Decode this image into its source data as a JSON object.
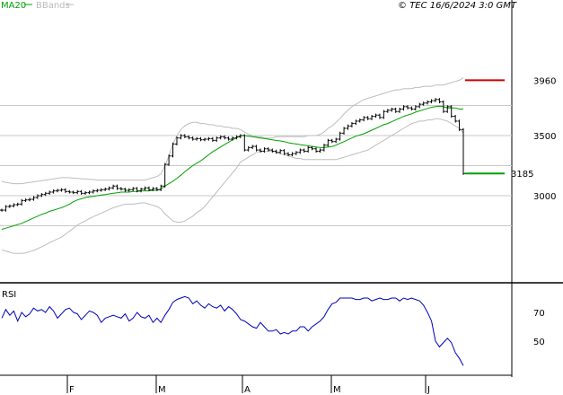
{
  "chart_data": [
    {
      "type": "candlestick",
      "copyright": "© TEC 16/6/2024 3:0 GMT",
      "legend": [
        {
          "name": "MA20",
          "color": "#00a000"
        },
        {
          "name": "BBands",
          "color": "#bbbbbb"
        }
      ],
      "y_ticks": [
        3000,
        3500
      ],
      "y_tick_labels": [
        "3000",
        "3500"
      ],
      "ylim": [
        2500,
        4000
      ],
      "resistance": {
        "value": 3960,
        "label": "3960",
        "color": "#cc0000"
      },
      "support": {
        "value": 3185,
        "label": "3185",
        "color": "#00a000"
      },
      "x_month_labels": [
        "F",
        "M",
        "A",
        "M",
        "J"
      ],
      "close": [
        2880,
        2910,
        2915,
        2925,
        2930,
        2960,
        2965,
        2970,
        2985,
        3000,
        3010,
        3020,
        3030,
        3040,
        3045,
        3050,
        3035,
        3030,
        3025,
        3035,
        3020,
        3025,
        3030,
        3040,
        3045,
        3050,
        3055,
        3065,
        3080,
        3060,
        3055,
        3045,
        3050,
        3060,
        3040,
        3055,
        3065,
        3050,
        3060,
        3050,
        3080,
        3260,
        3330,
        3430,
        3480,
        3500,
        3490,
        3480,
        3470,
        3475,
        3465,
        3470,
        3475,
        3460,
        3480,
        3490,
        3480,
        3470,
        3480,
        3490,
        3500,
        3380,
        3400,
        3410,
        3380,
        3370,
        3390,
        3380,
        3370,
        3360,
        3375,
        3350,
        3340,
        3350,
        3360,
        3380,
        3370,
        3400,
        3390,
        3370,
        3380,
        3420,
        3460,
        3450,
        3470,
        3520,
        3560,
        3580,
        3600,
        3620,
        3630,
        3650,
        3640,
        3660,
        3670,
        3650,
        3700,
        3710,
        3720,
        3700,
        3720,
        3740,
        3730,
        3720,
        3740,
        3760,
        3770,
        3780,
        3790,
        3800,
        3780,
        3700,
        3740,
        3660,
        3620,
        3550,
        3185
      ],
      "ma20": [
        2720,
        2730,
        2740,
        2750,
        2760,
        2770,
        2785,
        2800,
        2815,
        2830,
        2845,
        2855,
        2870,
        2880,
        2890,
        2900,
        2915,
        2930,
        2950,
        2965,
        2975,
        2985,
        2990,
        2995,
        3000,
        3005,
        3010,
        3015,
        3020,
        3025,
        3030,
        3030,
        3030,
        3035,
        3035,
        3040,
        3040,
        3040,
        3045,
        3045,
        3055,
        3080,
        3100,
        3120,
        3145,
        3170,
        3200,
        3225,
        3250,
        3270,
        3290,
        3315,
        3340,
        3365,
        3385,
        3405,
        3425,
        3445,
        3465,
        3480,
        3500,
        3500,
        3495,
        3490,
        3485,
        3480,
        3475,
        3470,
        3465,
        3460,
        3455,
        3450,
        3440,
        3435,
        3430,
        3425,
        3420,
        3415,
        3410,
        3405,
        3400,
        3400,
        3405,
        3410,
        3420,
        3435,
        3450,
        3465,
        3480,
        3495,
        3505,
        3515,
        3530,
        3545,
        3560,
        3575,
        3590,
        3600,
        3615,
        3630,
        3645,
        3660,
        3670,
        3680,
        3695,
        3705,
        3715,
        3725,
        3735,
        3740,
        3745,
        3740,
        3730,
        3730,
        3730,
        3720,
        3720
      ],
      "bb_upper": [
        3120,
        3110,
        3105,
        3100,
        3100,
        3100,
        3105,
        3110,
        3115,
        3120,
        3125,
        3130,
        3135,
        3140,
        3145,
        3150,
        3150,
        3150,
        3145,
        3145,
        3140,
        3140,
        3135,
        3135,
        3130,
        3130,
        3130,
        3130,
        3130,
        3130,
        3130,
        3130,
        3130,
        3130,
        3130,
        3130,
        3130,
        3140,
        3150,
        3160,
        3180,
        3250,
        3330,
        3430,
        3500,
        3550,
        3580,
        3600,
        3610,
        3610,
        3600,
        3600,
        3590,
        3590,
        3580,
        3580,
        3570,
        3570,
        3560,
        3560,
        3550,
        3530,
        3510,
        3500,
        3490,
        3490,
        3480,
        3480,
        3480,
        3490,
        3490,
        3490,
        3490,
        3490,
        3490,
        3490,
        3490,
        3500,
        3500,
        3500,
        3510,
        3530,
        3560,
        3580,
        3610,
        3640,
        3680,
        3710,
        3740,
        3760,
        3780,
        3800,
        3810,
        3820,
        3830,
        3840,
        3850,
        3860,
        3870,
        3880,
        3880,
        3890,
        3890,
        3890,
        3900,
        3900,
        3910,
        3910,
        3910,
        3920,
        3920,
        3920,
        3930,
        3940,
        3950,
        3960,
        3980
      ],
      "bb_lower": [
        2550,
        2540,
        2530,
        2520,
        2520,
        2520,
        2525,
        2535,
        2545,
        2560,
        2575,
        2590,
        2610,
        2625,
        2640,
        2655,
        2680,
        2705,
        2730,
        2755,
        2775,
        2790,
        2810,
        2825,
        2840,
        2855,
        2870,
        2885,
        2900,
        2910,
        2920,
        2930,
        2930,
        2930,
        2935,
        2940,
        2940,
        2930,
        2920,
        2910,
        2890,
        2850,
        2820,
        2790,
        2780,
        2780,
        2790,
        2810,
        2830,
        2860,
        2880,
        2910,
        2950,
        2990,
        3030,
        3070,
        3110,
        3150,
        3190,
        3230,
        3280,
        3300,
        3320,
        3340,
        3360,
        3370,
        3370,
        3370,
        3370,
        3360,
        3350,
        3340,
        3330,
        3320,
        3310,
        3310,
        3300,
        3300,
        3300,
        3300,
        3300,
        3300,
        3300,
        3300,
        3300,
        3310,
        3320,
        3330,
        3340,
        3350,
        3360,
        3370,
        3380,
        3400,
        3420,
        3440,
        3460,
        3480,
        3500,
        3520,
        3540,
        3560,
        3580,
        3600,
        3610,
        3620,
        3620,
        3630,
        3630,
        3640,
        3640,
        3630,
        3620,
        3600,
        3580,
        3560,
        3520
      ]
    },
    {
      "type": "line",
      "title": "RSI",
      "y_ticks": [
        50,
        70
      ],
      "y_tick_labels": [
        "50",
        "70"
      ],
      "ylim": [
        30,
        90
      ],
      "x_month_labels": [
        "F",
        "M",
        "A",
        "M",
        "J"
      ],
      "series": [
        {
          "name": "RSI",
          "color": "#0000bb",
          "values": [
            66,
            72,
            68,
            71,
            64,
            70,
            67,
            69,
            73,
            71,
            72,
            70,
            74,
            71,
            66,
            69,
            72,
            73,
            70,
            69,
            65,
            68,
            71,
            70,
            68,
            63,
            66,
            67,
            68,
            67,
            66,
            69,
            64,
            66,
            70,
            67,
            66,
            68,
            63,
            66,
            63,
            68,
            72,
            77,
            79,
            80,
            81,
            80,
            76,
            78,
            75,
            73,
            76,
            74,
            73,
            75,
            71,
            74,
            72,
            69,
            65,
            64,
            62,
            60,
            59,
            63,
            60,
            57,
            57,
            58,
            55,
            56,
            55,
            57,
            57,
            60,
            60,
            57,
            60,
            62,
            64,
            67,
            72,
            76,
            77,
            80,
            80,
            80,
            80,
            79,
            79,
            80,
            80,
            78,
            79,
            80,
            79,
            79,
            80,
            80,
            78,
            80,
            79,
            80,
            79,
            78,
            75,
            70,
            64,
            50,
            46,
            49,
            52,
            49,
            42,
            38,
            33
          ]
        }
      ]
    }
  ]
}
